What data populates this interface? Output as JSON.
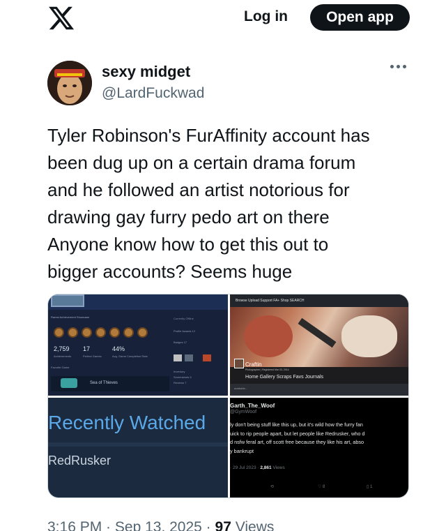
{
  "header": {
    "logo": "x-logo-icon",
    "login_label": "Log in",
    "open_app_label": "Open app"
  },
  "author": {
    "display_name": "sexy midget",
    "handle": "@LardFuckwad",
    "more_icon": "more-dots-icon"
  },
  "tweet": {
    "text": "Tyler Robinson's FurAffinity account has\nbeen dug up on a certain drama forum\nand he followed an artist notorious for\ndrawing gay furry pedo art on there\nAnyone know how to get this out to\nbigger accounts? Seems huge"
  },
  "media": {
    "steam_profile": {
      "showcase_label": "Rarest Achievement Showcase",
      "status": "Currently Offline",
      "stat1_value": "2,759",
      "stat1_label": "Achievements",
      "stat2_value": "17",
      "stat2_label": "Perfect Games",
      "stat3_value": "44%",
      "stat3_label": "Avg. Game Completion Rate",
      "profile_awards": "Profile Awards",
      "profile_awards_count": "12",
      "badges": "Badges",
      "badges_count": "17",
      "inventory": "Inventory",
      "screenshots": "Screenshots",
      "screenshots_count": "9",
      "reviews": "Reviews",
      "reviews_count": "7",
      "favorite_game_label": "Favorite Game",
      "favorite_game": "Sea of Thieves"
    },
    "furaffinity": {
      "nav": "Browse   Upload   Support   FA+   Shop   SEARCH",
      "username": "Craftin",
      "subtitle": "Photographer | Registered Mar 03, 2014",
      "tabs": "Home  Gallery  Scraps  Favs  Journals",
      "footer": "available..."
    },
    "recently_watched": {
      "title": "Recently Watched",
      "name": "RedRusker"
    },
    "quoted_post": {
      "display_name": "Garth_The_Woof",
      "handle": "@GymWoof",
      "text": "ly don't being stuff like this up, but it's wild how the furry fan\nuick to rip people apart, but let people like Redrusker, who d\nd nsfw feral art, off scott free because they like his art, abso\ny bankrupt",
      "date": "29 Jul 2023",
      "views": "2,861",
      "views_label": "Views",
      "likes": "8",
      "bookmarks": "1"
    }
  },
  "footer": {
    "time": "3:16 PM",
    "sep": " · ",
    "date": "Sep 13, 2025",
    "views": "97",
    "views_label": "Views"
  }
}
